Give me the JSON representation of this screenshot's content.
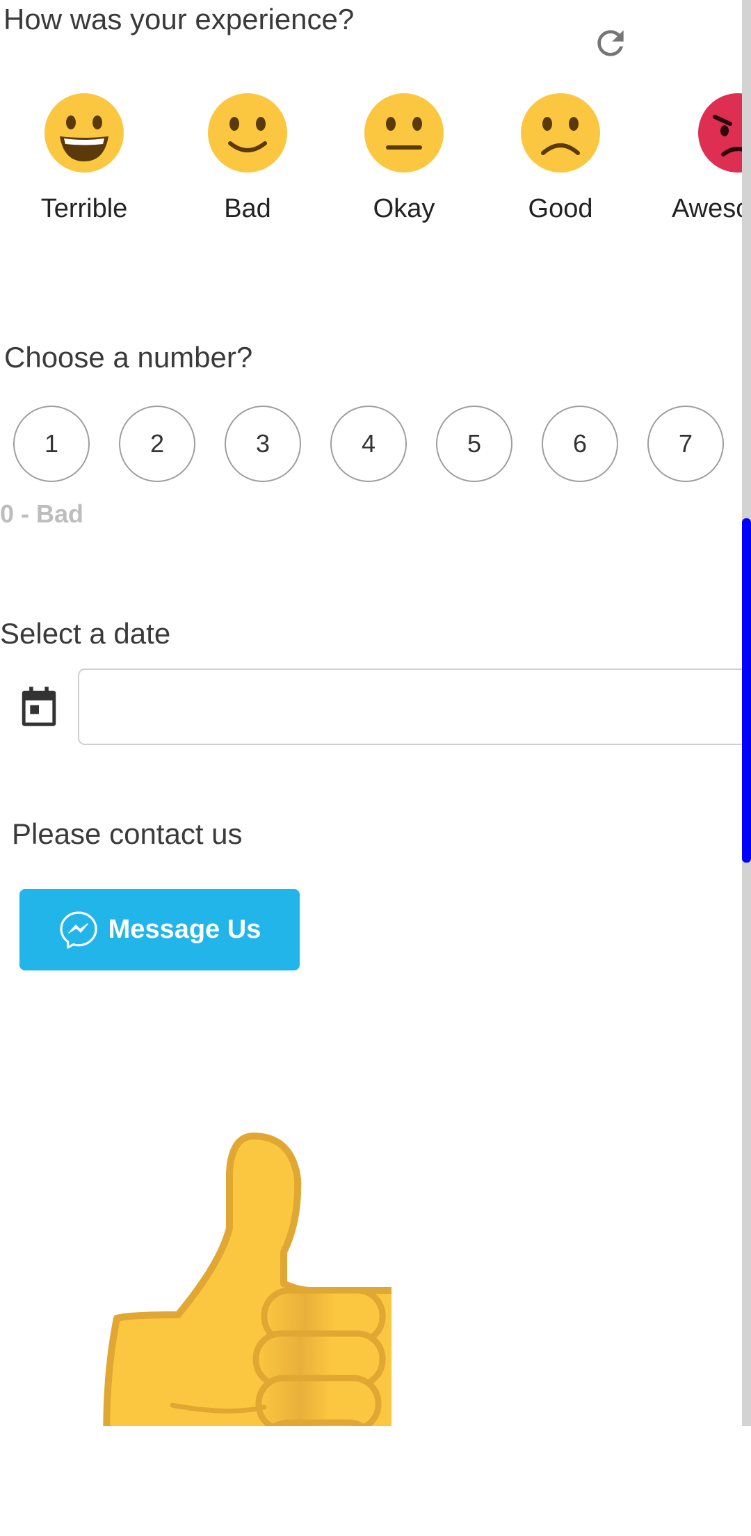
{
  "experience": {
    "question": "How was your experience?",
    "options": [
      {
        "label": "Terrible",
        "icon": "grinning-face-icon"
      },
      {
        "label": "Bad",
        "icon": "slightly-smiling-face-icon"
      },
      {
        "label": "Okay",
        "icon": "neutral-face-icon"
      },
      {
        "label": "Good",
        "icon": "frowning-face-icon"
      },
      {
        "label": "Awesome",
        "icon": "angry-face-icon"
      }
    ]
  },
  "number": {
    "question": "Choose a number?",
    "options": [
      "1",
      "2",
      "3",
      "4",
      "5",
      "6",
      "7"
    ],
    "range_note": "0 - Bad"
  },
  "date": {
    "label": "Select a date",
    "value": "",
    "placeholder": ""
  },
  "contact": {
    "label": "Please contact us",
    "button_label": "Message Us"
  },
  "colors": {
    "accent": "#22b5e9",
    "emoji_yellow": "#fcc740",
    "emoji_red": "#de2f52",
    "scrollbar": "#0000ff"
  },
  "icons": {
    "refresh": "refresh-icon",
    "calendar": "calendar-icon",
    "messenger": "messenger-icon",
    "illustration": "thumbs-up-icon"
  }
}
